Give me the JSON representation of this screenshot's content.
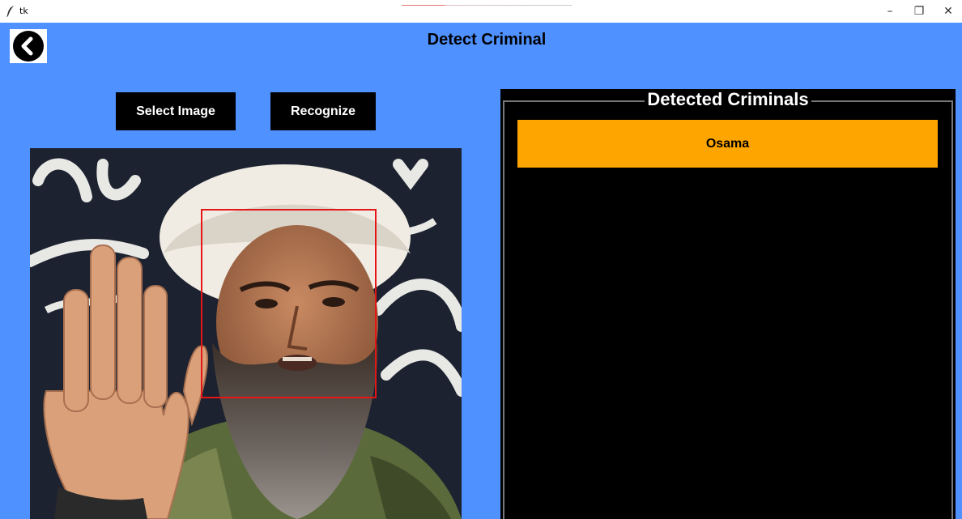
{
  "window": {
    "title": "tk",
    "minimize_glyph": "–",
    "maximize_glyph": "❐",
    "close_glyph": "✕"
  },
  "header": {
    "title": "Detect Criminal",
    "back_icon": "chevron-left-circle-icon"
  },
  "toolbar": {
    "select_label": "Select Image",
    "recognize_label": "Recognize"
  },
  "image": {
    "face_detected": true
  },
  "results": {
    "title": "Detected Criminals",
    "items": [
      {
        "name": "Osama"
      }
    ]
  },
  "colors": {
    "background": "#4f91ff",
    "button_bg": "#000000",
    "button_text": "#ffffff",
    "result_item_bg": "#ffa500",
    "face_box": "#e61616"
  }
}
